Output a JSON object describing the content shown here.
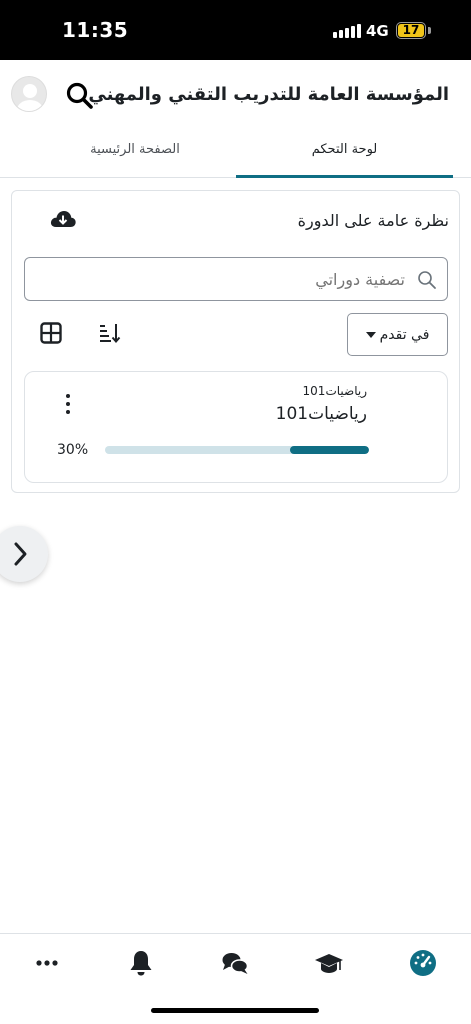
{
  "status_bar": {
    "time": "11:35",
    "network": "4G",
    "battery": "17"
  },
  "header": {
    "title": "المؤسسة العامة للتدريب التقني والمهني"
  },
  "tabs": [
    {
      "label": "لوحة التحكم",
      "active": true
    },
    {
      "label": "الصفحة الرئيسية",
      "active": false
    }
  ],
  "course_overview": {
    "title": "نظرة عامة على الدورة",
    "filter_placeholder": "تصفية دوراتي",
    "status_filter": "في تقدم",
    "courses": [
      {
        "category": "رياضيات101",
        "name": "رياضيات101",
        "progress_label": "30%",
        "progress": 0.3
      }
    ]
  },
  "icons": {
    "download": "cloud-download-icon",
    "search": "search-icon",
    "grid": "grid-view-icon",
    "sort": "sort-icon",
    "more": "more-vertical-icon",
    "drawer": "chevron-right-icon",
    "nav": [
      "more-horizontal-icon",
      "bell-icon",
      "chat-icon",
      "graduation-cap-icon",
      "dashboard-icon"
    ]
  },
  "colors": {
    "accent": "#0f6e84",
    "progress_track": "#cfe2e8",
    "text": "#1d2125"
  }
}
